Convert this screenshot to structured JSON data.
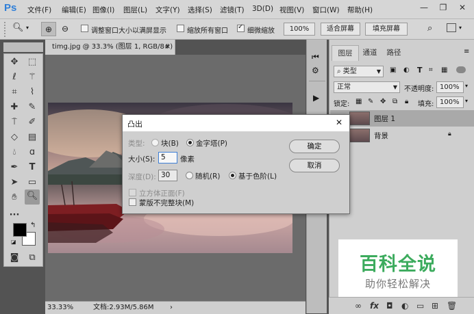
{
  "app": {
    "logo": "Ps"
  },
  "menubar": {
    "items": [
      "文件(F)",
      "编辑(E)",
      "图像(I)",
      "图层(L)",
      "文字(Y)",
      "选择(S)",
      "滤镜(T)",
      "3D(D)",
      "视图(V)",
      "窗口(W)",
      "帮助(H)"
    ]
  },
  "window_controls": {
    "minimize": "—",
    "restore": "❐",
    "close": "✕"
  },
  "options": {
    "resize_windows": "调整窗口大小以满屏显示",
    "zoom_all": "缩放所有窗口",
    "scrubby_zoom": "细微缩放",
    "zoom_pct": "100%",
    "fit_screen": "适合屏幕",
    "fill_screen": "填充屏幕",
    "resize_checked": false,
    "zoom_all_checked": false,
    "scrubby_checked": true
  },
  "document": {
    "tab_title": "timg.jpg @ 33.3% (图层 1, RGB/8#) *",
    "tab_close": "×",
    "zoom": "33.33%",
    "doc_size": "文档:2.93M/5.86M"
  },
  "layers_panel": {
    "tabs": [
      "图层",
      "通道",
      "路径"
    ],
    "filter_kind": "类型",
    "blend_mode": "正常",
    "opacity_label": "不透明度:",
    "opacity": "100%",
    "lock_label": "锁定:",
    "fill_label": "填充:",
    "fill": "100%",
    "layers": [
      {
        "name": "图层 1",
        "selected": true
      },
      {
        "name": "背景",
        "selected": false,
        "locked": true
      }
    ]
  },
  "dialog": {
    "title": "凸出",
    "close": "✕",
    "type_label": "类型:",
    "type_options": [
      "块(B)",
      "金字塔(P)"
    ],
    "size_label": "大小(S):",
    "size_value": "5",
    "size_unit": "像素",
    "depth_label": "深度(D):",
    "depth_value": "30",
    "depth_options": [
      "随机(R)",
      "基于色阶(L)"
    ],
    "solid_front": "立方体正面(F)",
    "mask_incomplete": "蒙版不完整块(M)",
    "ok": "确定",
    "cancel": "取消"
  },
  "watermark": {
    "title": "百科全说",
    "subtitle": "助你轻松解决"
  },
  "colors": {
    "accent": "#3d7ed6",
    "watermark_green": "#3cab5d"
  }
}
